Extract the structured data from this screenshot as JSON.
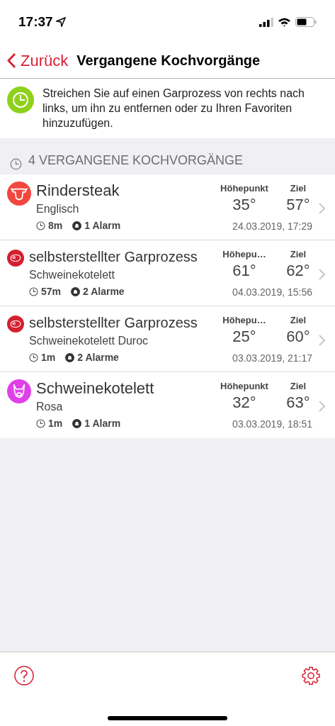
{
  "status_bar": {
    "time": "17:37"
  },
  "nav": {
    "back": "Zurück",
    "title": "Vergangene Kochvorgänge"
  },
  "hint": {
    "text": "Streichen Sie auf einen Garprozess von rechts nach links, um ihn zu entfernen oder zu Ihren Favoriten hinzuzufügen."
  },
  "section": {
    "title": "4 VERGANGENE KOCHVORGÄNGE"
  },
  "sessions": [
    {
      "kind": "beef",
      "color": "#f2473f",
      "title": "Rindersteak",
      "subtitle": "Englisch",
      "duration": "8m",
      "alarms": "1 Alarm",
      "peak_label": "Höhepunkt",
      "peak": "35°",
      "target_label": "Ziel",
      "target": "57°",
      "date": "24.03.2019, 17:29"
    },
    {
      "kind": "custom",
      "color": "#d42030",
      "title": "selbsterstellter Garprozess",
      "subtitle": "Schweinekotelett",
      "duration": "57m",
      "alarms": "2 Alarme",
      "peak_label": "Höhepu…",
      "peak": "61°",
      "target_label": "Ziel",
      "target": "62°",
      "date": "04.03.2019, 15:56"
    },
    {
      "kind": "custom",
      "color": "#d42030",
      "title": "selbsterstellter Garprozess",
      "subtitle": "Schweinekotelett Duroc",
      "duration": "1m",
      "alarms": "2 Alarme",
      "peak_label": "Höhepu…",
      "peak": "25°",
      "target_label": "Ziel",
      "target": "60°",
      "date": "03.03.2019, 21:17"
    },
    {
      "kind": "pork",
      "color": "#e040e8",
      "title": "Schweinekotelett",
      "subtitle": "Rosa",
      "duration": "1m",
      "alarms": "1 Alarm",
      "peak_label": "Höhepunkt",
      "peak": "32°",
      "target_label": "Ziel",
      "target": "63°",
      "date": "03.03.2019, 18:51"
    }
  ]
}
